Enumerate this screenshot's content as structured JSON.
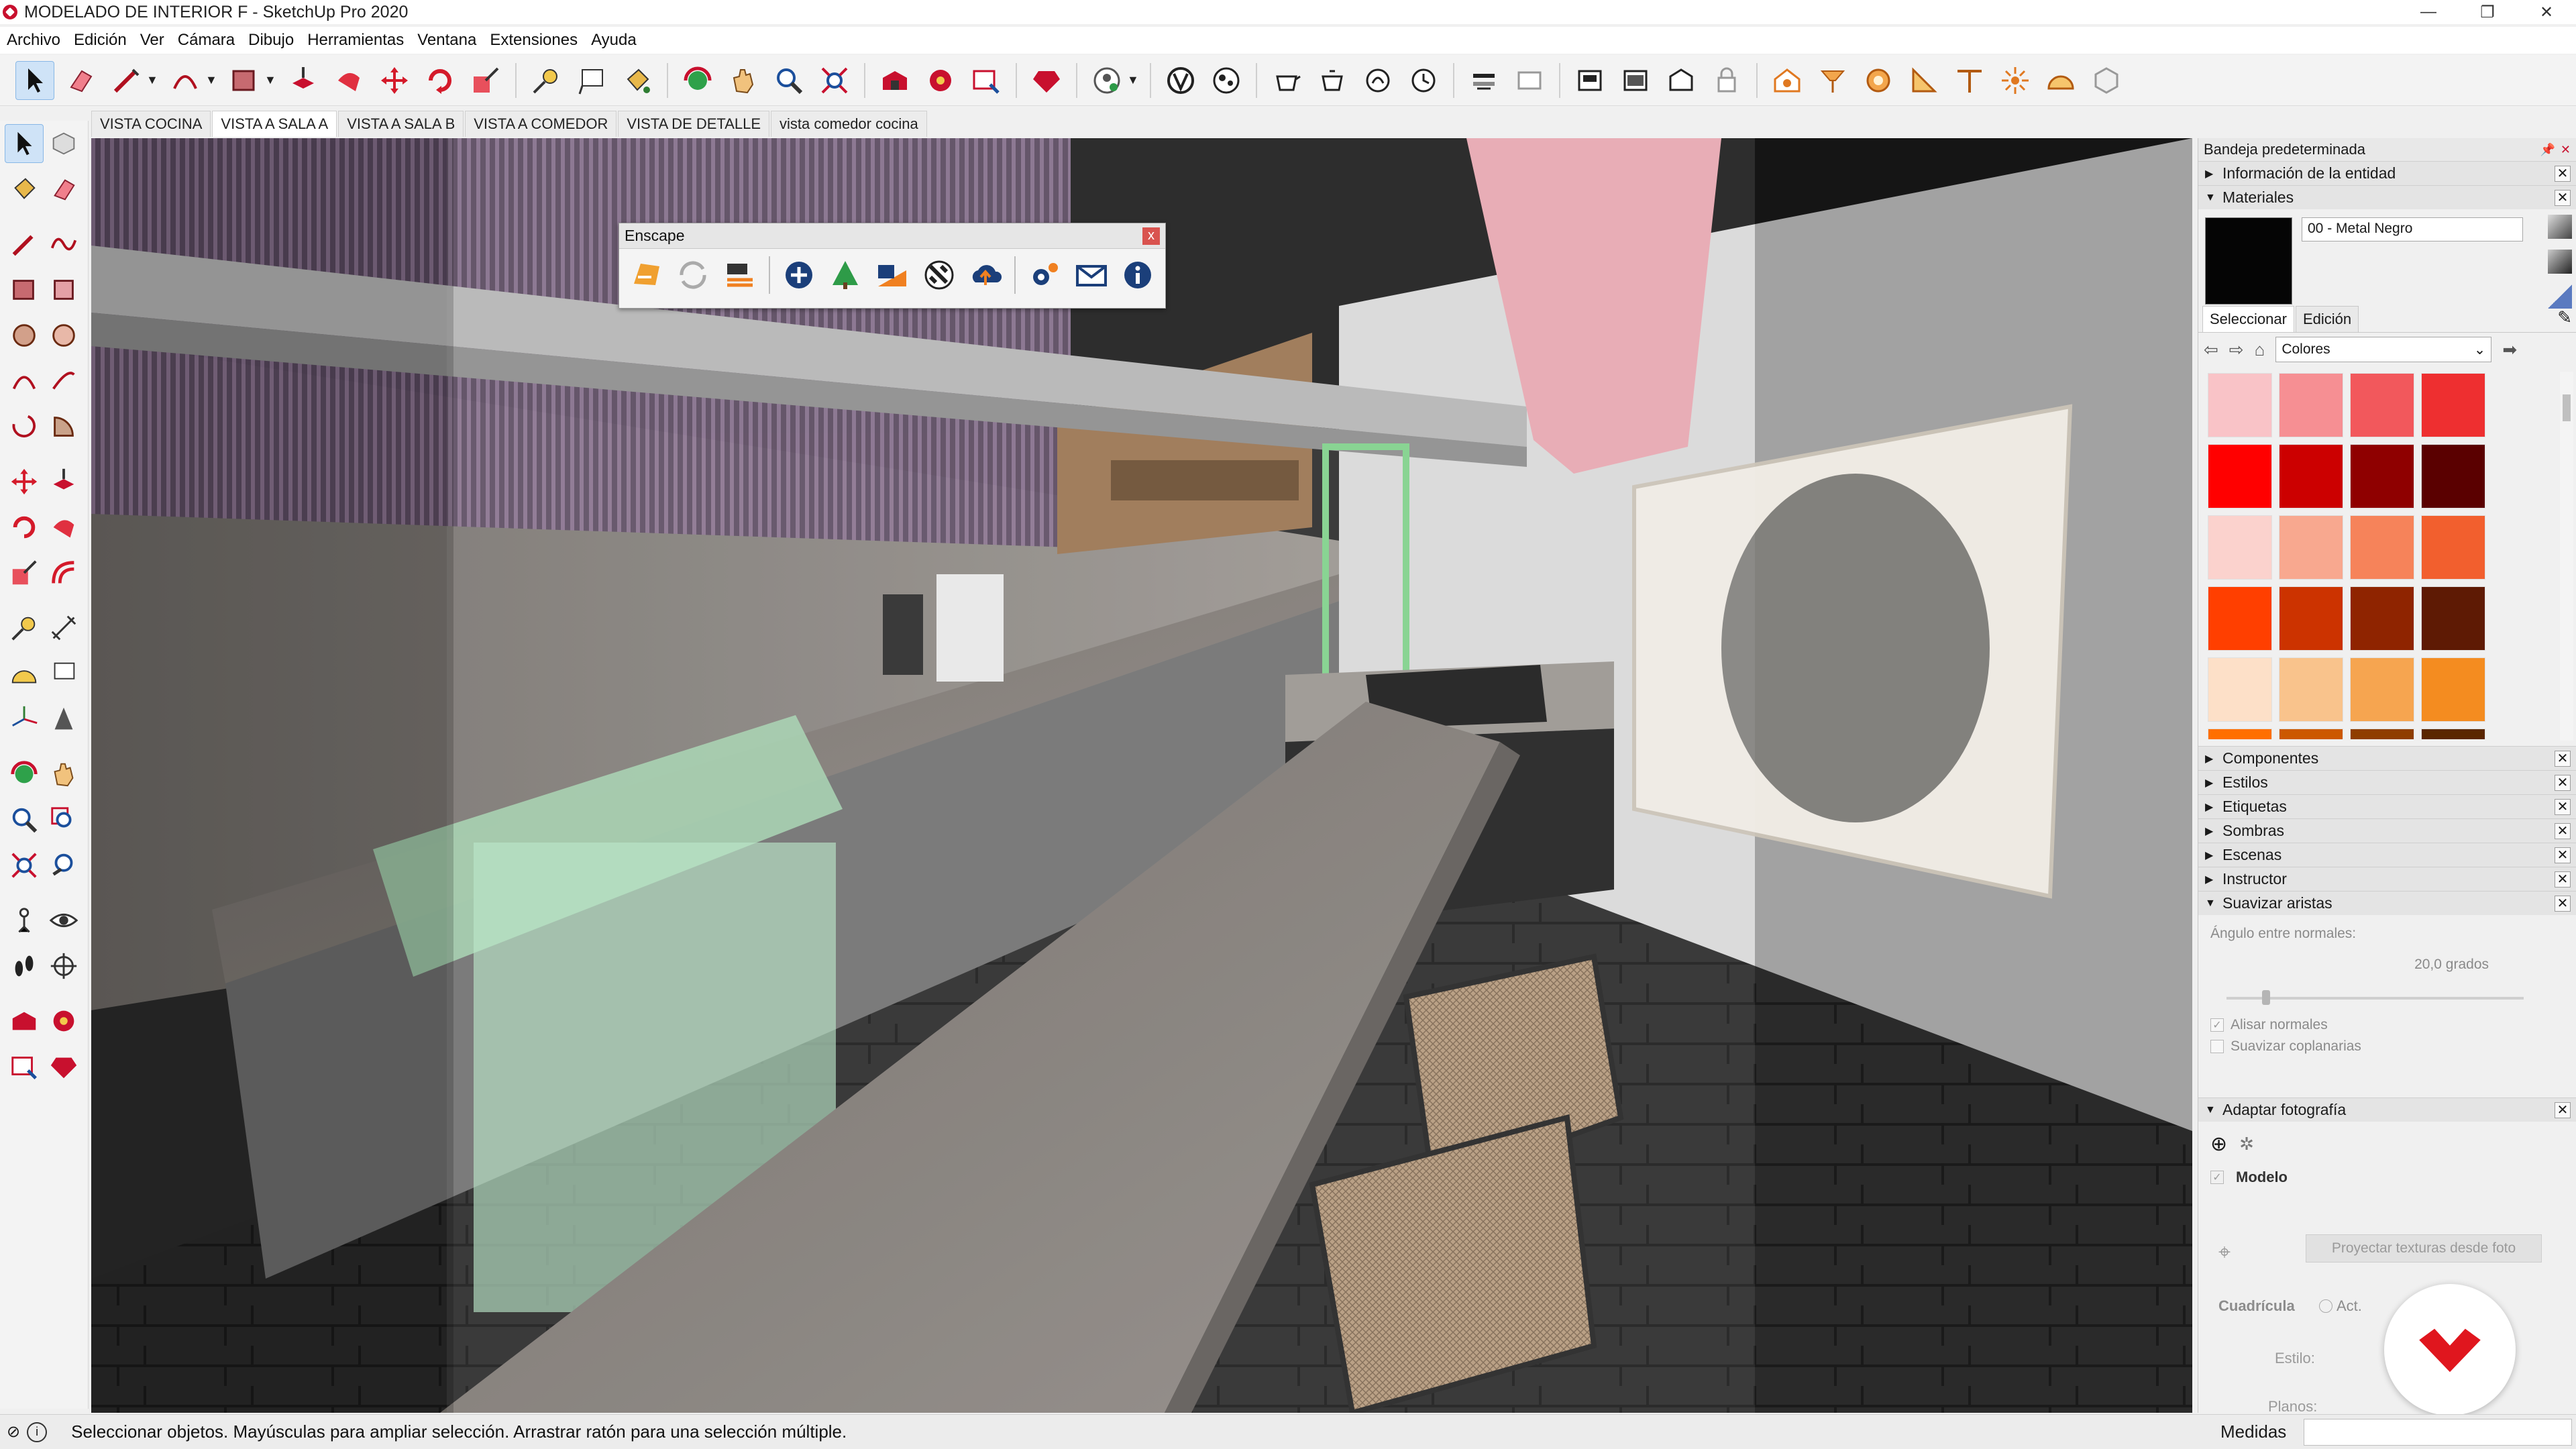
{
  "window": {
    "title": "MODELADO DE INTERIOR F - SketchUp Pro 2020",
    "controls": {
      "minimize": "—",
      "restore": "❐",
      "close": "✕"
    }
  },
  "menu": {
    "items": [
      "Archivo",
      "Edición",
      "Ver",
      "Cámara",
      "Dibujo",
      "Herramientas",
      "Ventana",
      "Extensiones",
      "Ayuda"
    ]
  },
  "scenes": {
    "tabs": [
      "VISTA COCINA",
      "VISTA A SALA A",
      "VISTA A SALA B",
      "VISTA A COMEDOR",
      "VISTA DE DETALLE",
      "vista comedor cocina"
    ],
    "active_index": 1
  },
  "enscape": {
    "title": "Enscape",
    "close": "x"
  },
  "tray": {
    "title": "Bandeja predeterminada",
    "entity_info": "Información de la entidad",
    "materials": {
      "title": "Materiales",
      "current_name": "00 - Metal Negro",
      "current_color": "#050505",
      "tabs": [
        "Seleccionar",
        "Edición"
      ],
      "library": "Colores",
      "swatches": [
        "#f9c3c7",
        "#f68f93",
        "#f2585c",
        "#ee2f30",
        "#ff0000",
        "#cc0000",
        "#8f0000",
        "#5a0000",
        "#fbd2cd",
        "#f8a88f",
        "#f6835a",
        "#f25f2e",
        "#ff3f00",
        "#cc3300",
        "#8f2400",
        "#5e1a04",
        "#fde0c8",
        "#f9c38c",
        "#f6a550",
        "#f48c20",
        "#ff6f00",
        "#cc5800",
        "#8f3d00",
        "#5a2600"
      ]
    },
    "panels": [
      "Componentes",
      "Estilos",
      "Etiquetas",
      "Sombras",
      "Escenas",
      "Instructor"
    ],
    "smooth_edges": {
      "title": "Suavizar aristas",
      "angle_label": "Ángulo entre normales:",
      "angle_value": "20,0  grados",
      "angle_fraction": 0.12,
      "smooth_normals": "Alisar normales",
      "smooth_normals_checked": true,
      "soften_coplanar": "Suavizar coplanarias",
      "soften_coplanar_checked": false
    },
    "match_photo": {
      "title": "Adaptar fotografía",
      "model": "Modelo",
      "project_button": "Proyectar texturas desde foto",
      "grid": "Cuadrícula",
      "act": "Act.",
      "style": "Estilo:",
      "planes": "Planos:"
    }
  },
  "status": {
    "text": "Seleccionar objetos. Mayúsculas para ampliar selección. Arrastrar ratón para una selección múltiple.",
    "measures_label": "Medidas",
    "measures_value": ""
  }
}
